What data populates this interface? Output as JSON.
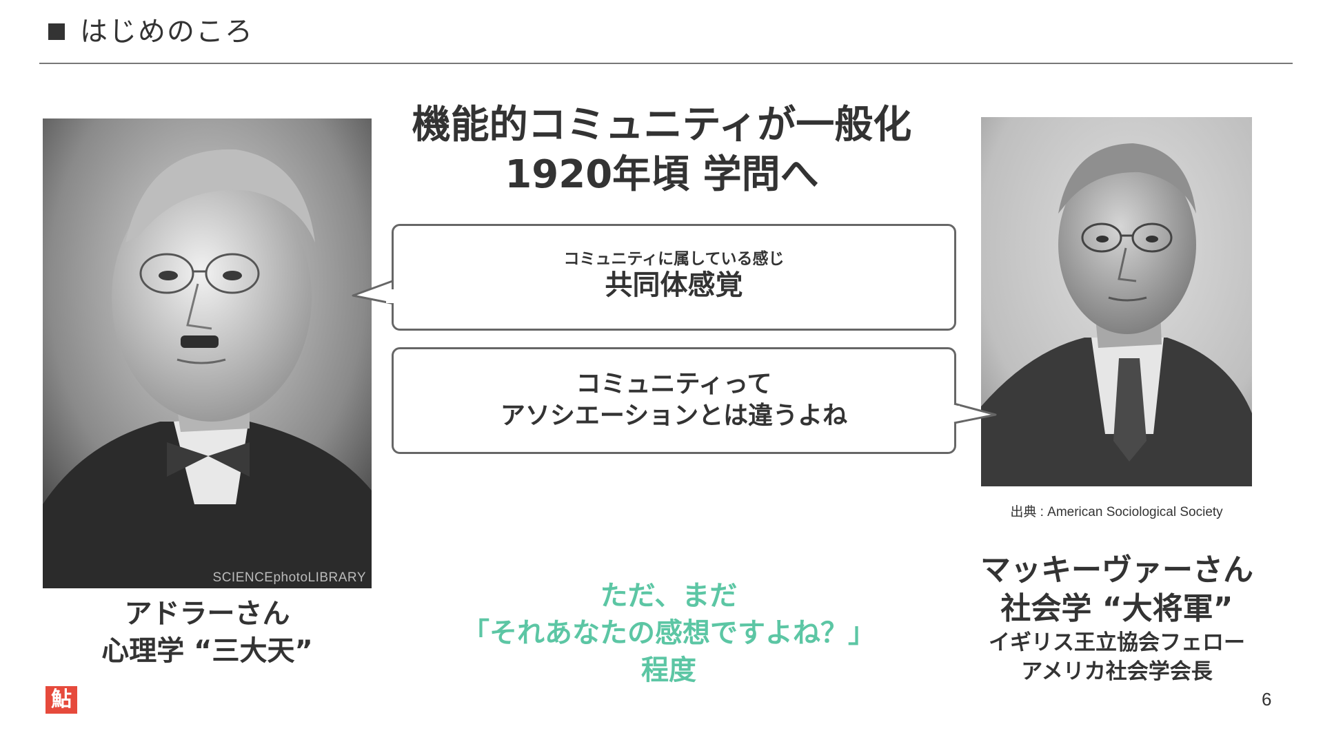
{
  "header": {
    "title": "はじめのころ"
  },
  "headline": {
    "line1": "機能的コミュニティが一般化",
    "line2": "1920年頃 学問へ"
  },
  "bubble_top": {
    "small": "コミュニティに属している感じ",
    "big": "共同体感覚"
  },
  "bubble_bottom": {
    "line1": "コミュニティって",
    "line2": "アソシエーションとは違うよね"
  },
  "left_person": {
    "watermark": "SCIENCEphotoLIBRARY",
    "name": "アドラーさん",
    "title": "心理学 “三大天”"
  },
  "right_person": {
    "source": "出典 : American Sociological Society",
    "name": "マッキーヴァーさん",
    "title": "社会学 “大将軍”",
    "role1": "イギリス王立協会フェロー",
    "role2": "アメリカ社会学会長"
  },
  "note": {
    "line1": "ただ、まだ",
    "line2": "「それあなたの感想ですよね？」",
    "line3": "程度",
    "color": "#5cc6a4"
  },
  "footer": {
    "logo_char": "鮎",
    "page": "6",
    "logo_color": "#e64a3c"
  }
}
